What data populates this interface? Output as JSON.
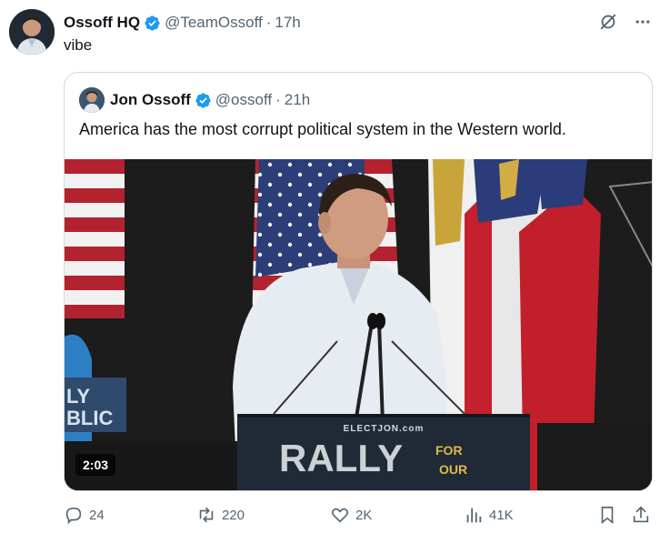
{
  "author": {
    "name": "Ossoff HQ",
    "handle": "@TeamOssoff",
    "time": "17h",
    "verified": true
  },
  "tweet": {
    "text": "vibe"
  },
  "quoted": {
    "name": "Jon Ossoff",
    "handle": "@ossoff",
    "time": "21h",
    "verified": true,
    "text": "America has the most corrupt political system in the Western world.",
    "video": {
      "duration": "2:03",
      "podium_top": "ELECTJON.com",
      "podium_main": "RALLY",
      "podium_side_top": "FOR",
      "podium_side_bottom": "OUR",
      "sign_left_top": "LY",
      "sign_left_bottom": "BLIC"
    }
  },
  "actions": {
    "replies": "24",
    "reposts": "220",
    "likes": "2K",
    "views": "41K"
  },
  "colors": {
    "text": "#0f1419",
    "muted": "#536471",
    "verified": "#1d9bf0",
    "border": "#cfd9de"
  },
  "icons": [
    "grok-icon",
    "more-icon",
    "reply-icon",
    "repost-icon",
    "like-icon",
    "views-icon",
    "bookmark-icon",
    "share-icon",
    "verified-badge-icon"
  ]
}
